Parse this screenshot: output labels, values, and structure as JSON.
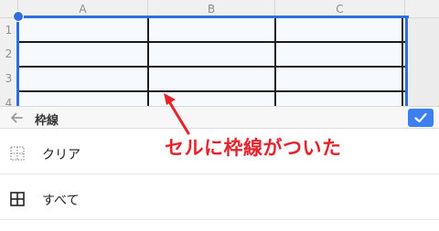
{
  "sheet": {
    "columns": [
      "A",
      "B",
      "C"
    ],
    "rows": [
      "1",
      "2",
      "3",
      "4"
    ]
  },
  "toolbar": {
    "title": "枠線",
    "back_icon": "arrow-left-icon",
    "done_icon": "checkmark-icon"
  },
  "border_options": [
    {
      "label": "クリア",
      "icon": "border-none-icon"
    },
    {
      "label": "すべて",
      "icon": "border-all-icon"
    }
  ],
  "annotation": {
    "text": "セルに枠線がついた",
    "color": "#e8212a"
  },
  "colors": {
    "selection": "#2d6fe0",
    "done_button": "#3b7ff0"
  }
}
